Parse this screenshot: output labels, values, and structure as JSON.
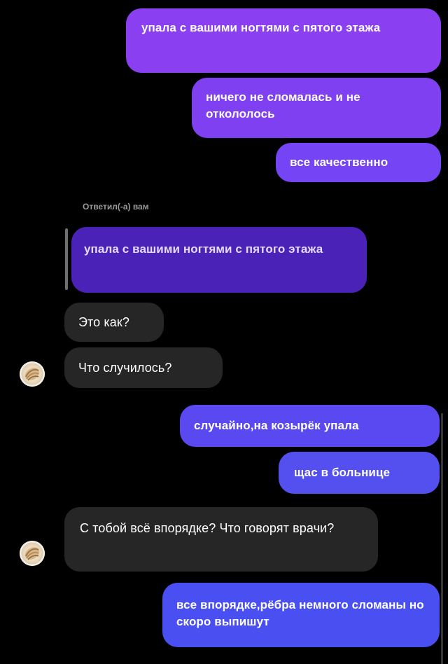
{
  "chat": {
    "messages": [
      {
        "text": "упала с вашими ногтями с пятого этажа",
        "from": "me",
        "color": "#8a3ff0"
      },
      {
        "text": "ничего не сломалась и не откололось",
        "from": "me",
        "color": "#7f40f2"
      },
      {
        "text": "все качественно",
        "from": "me",
        "color": "#7444f5"
      },
      {
        "text": "Это как?",
        "from": "them"
      },
      {
        "text": "Что случилось?",
        "from": "them"
      },
      {
        "text": "случайно,на козырёк упала",
        "from": "me",
        "color": "#5a49f0"
      },
      {
        "text": "щас в больнице",
        "from": "me",
        "color": "#5450f0"
      },
      {
        "text": "С тобой всё впорядке? Что говорят врачи?",
        "from": "them"
      },
      {
        "text": "все впорядке,рёбра немного сломаны но скоро выпишут",
        "from": "me",
        "color": "#4a4ff2"
      }
    ],
    "reply": {
      "label": "Ответил(-а) вам",
      "quoted_text": "упала с вашими ногтями с пятого этажа",
      "color": "#4b22b8"
    },
    "avatar_icon": "avatar-icon"
  }
}
